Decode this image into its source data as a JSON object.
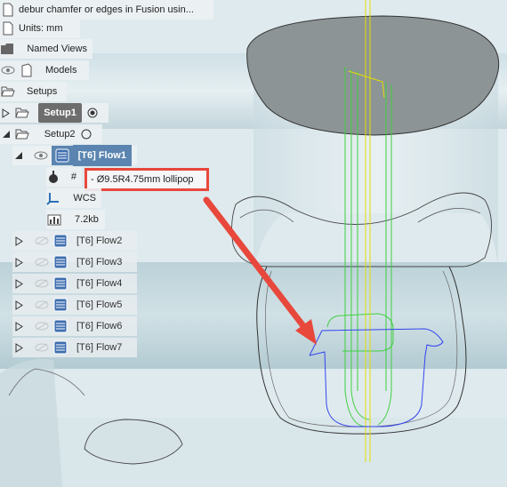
{
  "browser": {
    "doc_title": "debur chamfer or edges in Fusion usin...",
    "units": "Units: mm",
    "named_views": "Named Views",
    "models": "Models",
    "setups": "Setups",
    "setup1": "Setup1",
    "setup2": "Setup2",
    "active_op": "[T6] Flow1",
    "tool_hash": "#",
    "tool": "- Ø9.5R4.75mm lollipop",
    "wcs": "WCS",
    "size": "7.2kb",
    "ops": [
      "[T6] Flow2",
      "[T6] Flow3",
      "[T6] Flow4",
      "[T6] Flow5",
      "[T6] Flow6",
      "[T6] Flow7"
    ]
  },
  "icons": {
    "document": "document-icon",
    "units": "ruler-icon",
    "named_views": "folder-icon",
    "eye": "eye-icon",
    "models": "model-icon",
    "setups": "folder-open-icon",
    "tool": "tool-icon",
    "wcs": "axis-icon",
    "size": "stats-icon"
  },
  "colors": {
    "highlight": "#e8483c",
    "selected_op": "#5b85b0",
    "toolpath_green": "#3fcf3f",
    "toolpath_blue": "#3344ee",
    "toolpath_yellow": "#e3e000"
  }
}
